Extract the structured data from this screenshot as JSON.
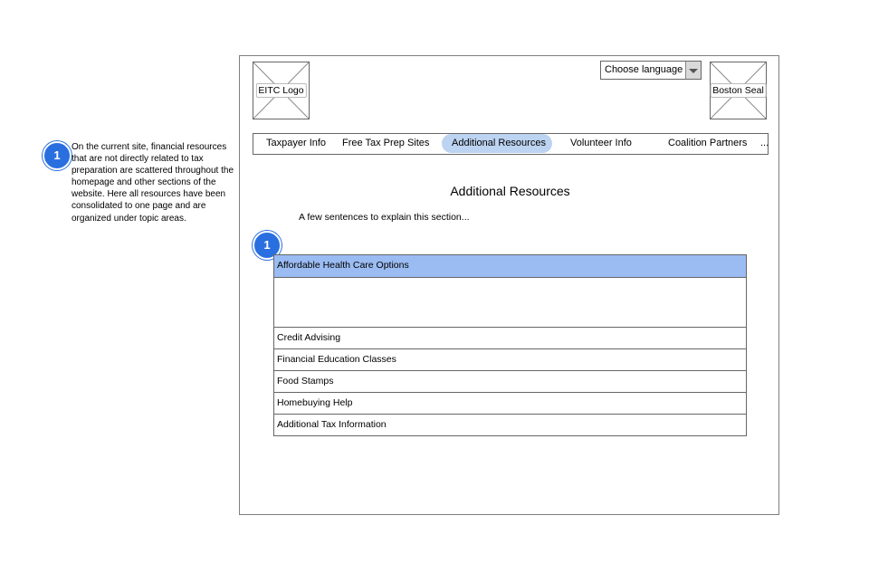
{
  "annotation": {
    "badge": "1",
    "text": "On the current site, financial resources that are not directly related to tax preparation are scattered throughout the homepage and other sections of the website. Here all resources have been consolidated to one page and are organized under topic areas."
  },
  "header": {
    "logo_label": "EITC Logo",
    "seal_label": "Boston Seal",
    "language": {
      "selected": "Choose language"
    }
  },
  "nav": {
    "items": [
      "Taxpayer Info",
      "Free Tax Prep Sites",
      "Additional Resources",
      "Volunteer Info",
      "Coalition Partners"
    ],
    "active": "Additional Resources",
    "overflow": "..."
  },
  "main": {
    "title": "Additional Resources",
    "intro": "A few sentences to explain this section...",
    "badge": "1",
    "accordion": {
      "open_item": "Affordable Health Care Options",
      "items": [
        "Credit Advising",
        "Financial Education Classes",
        "Food Stamps",
        "Homebuying Help",
        "Additional Tax Information"
      ]
    }
  },
  "colors": {
    "badge": "#2a6fe0",
    "active_nav": "#bcd3f1",
    "open_row": "#9bbcf2"
  }
}
